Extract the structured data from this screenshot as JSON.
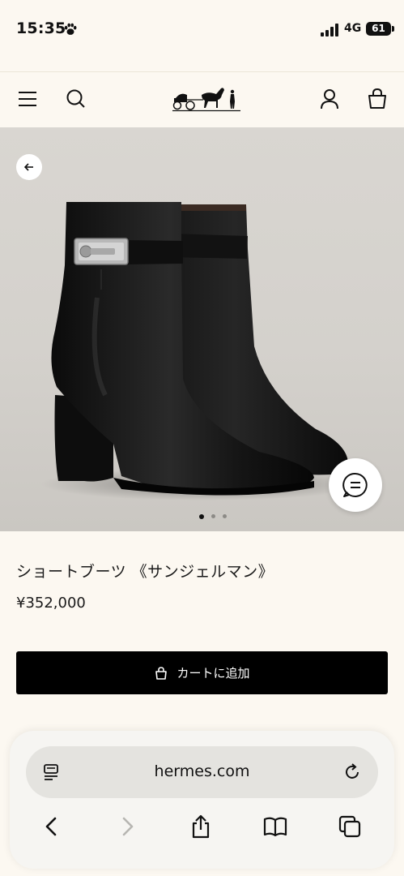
{
  "status": {
    "time": "15:35",
    "network": "4G",
    "battery": "61"
  },
  "header": {
    "brand": "Hermès"
  },
  "product": {
    "title": "ショートブーツ 《サンジェルマン》",
    "price": "¥352,000",
    "carousel": {
      "count": 3,
      "active": 1
    }
  },
  "actions": {
    "add_to_cart": "カートに追加"
  },
  "browser": {
    "url": "hermes.com"
  },
  "colors": {
    "background": "#fcf8f1",
    "button": "#000000",
    "hero_bg": "#d6d3ce"
  }
}
